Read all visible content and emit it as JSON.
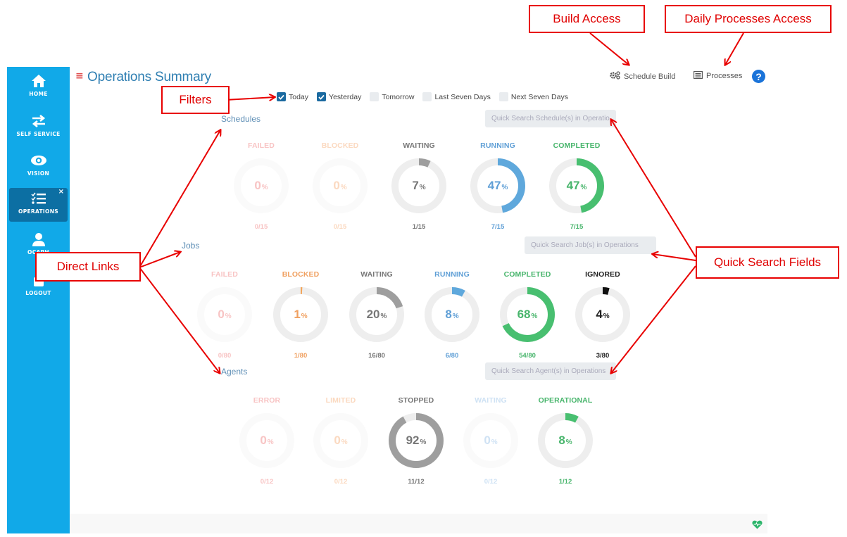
{
  "sidebar": {
    "items": [
      {
        "label": "HOME",
        "icon": "home-icon",
        "active": false
      },
      {
        "label": "SELF SERVICE",
        "icon": "swap-arrows-icon",
        "active": false
      },
      {
        "label": "VISION",
        "icon": "eye-icon",
        "active": false
      },
      {
        "label": "OPERATIONS",
        "icon": "checklist-icon",
        "active": true,
        "close": "×"
      },
      {
        "label": "OCAPH",
        "icon": "user-icon",
        "active": false
      },
      {
        "label": "LOGOUT",
        "icon": "logout-icon",
        "active": false
      }
    ]
  },
  "header": {
    "menu_icon": "≡",
    "title": "Operations Summary",
    "schedule_build": "Schedule Build",
    "processes": "Processes",
    "help": "?"
  },
  "filters": [
    {
      "label": "Today",
      "checked": true
    },
    {
      "label": "Yesterday",
      "checked": true
    },
    {
      "label": "Tomorrow",
      "checked": false
    },
    {
      "label": "Last Seven Days",
      "checked": false
    },
    {
      "label": "Next Seven Days",
      "checked": false
    }
  ],
  "sections": {
    "schedules": {
      "label": "Schedules",
      "search_placeholder": "Quick Search Schedule(s) in Operations",
      "tiles": [
        {
          "title": "FAILED",
          "percent": 0,
          "count": "0/15",
          "color": "#f6b8b8",
          "text_color": "#f8c4c4",
          "muted": true
        },
        {
          "title": "BLOCKED",
          "percent": 0,
          "count": "0/15",
          "color": "#fbd3b5",
          "text_color": "#fbd9c0",
          "muted": true
        },
        {
          "title": "WAITING",
          "percent": 7,
          "count": "1/15",
          "color": "#9e9e9e",
          "text_color": "#777777",
          "muted": false
        },
        {
          "title": "RUNNING",
          "percent": 47,
          "count": "7/15",
          "color": "#5fa8dc",
          "text_color": "#5f9fd6",
          "muted": false
        },
        {
          "title": "COMPLETED",
          "percent": 47,
          "count": "7/15",
          "color": "#48bf70",
          "text_color": "#48b56c",
          "muted": false
        }
      ]
    },
    "jobs": {
      "label": "Jobs",
      "search_placeholder": "Quick Search Job(s) in Operations",
      "tiles": [
        {
          "title": "FAILED",
          "percent": 0,
          "count": "0/80",
          "color": "#f6b8b8",
          "text_color": "#f8c4c4",
          "muted": true
        },
        {
          "title": "BLOCKED",
          "percent": 1,
          "count": "1/80",
          "color": "#f3a55a",
          "text_color": "#f0a060",
          "muted": false
        },
        {
          "title": "WAITING",
          "percent": 20,
          "count": "16/80",
          "color": "#9e9e9e",
          "text_color": "#777777",
          "muted": false
        },
        {
          "title": "RUNNING",
          "percent": 8,
          "count": "6/80",
          "color": "#5fa8dc",
          "text_color": "#5f9fd6",
          "muted": false
        },
        {
          "title": "COMPLETED",
          "percent": 68,
          "count": "54/80",
          "color": "#48bf70",
          "text_color": "#48b56c",
          "muted": false
        },
        {
          "title": "IGNORED",
          "percent": 4,
          "count": "3/80",
          "color": "#111111",
          "text_color": "#222222",
          "muted": false
        }
      ]
    },
    "agents": {
      "label": "Agents",
      "search_placeholder": "Quick Search Agent(s) in Operations",
      "tiles": [
        {
          "title": "ERROR",
          "percent": 0,
          "count": "0/12",
          "color": "#f6b8b8",
          "text_color": "#f8c4c4",
          "muted": true
        },
        {
          "title": "LIMITED",
          "percent": 0,
          "count": "0/12",
          "color": "#fbd3b5",
          "text_color": "#fbd9c0",
          "muted": true
        },
        {
          "title": "STOPPED",
          "percent": 92,
          "count": "11/12",
          "color": "#9e9e9e",
          "text_color": "#777777",
          "muted": false
        },
        {
          "title": "WAITING",
          "percent": 0,
          "count": "0/12",
          "color": "#c7def3",
          "text_color": "#cfe2f4",
          "muted": true
        },
        {
          "title": "OPERATIONAL",
          "percent": 8,
          "count": "1/12",
          "color": "#48bf70",
          "text_color": "#48b56c",
          "muted": false
        }
      ]
    }
  },
  "footer": {
    "status_icon": "heartbeat-icon",
    "status_color": "#2bb56a"
  },
  "annotations": {
    "build_access": "Build Access",
    "daily_processes_access": "Daily Processes Access",
    "filters": "Filters",
    "direct_links": "Direct Links",
    "quick_search_fields": "Quick Search Fields",
    "color": "#e00000"
  }
}
